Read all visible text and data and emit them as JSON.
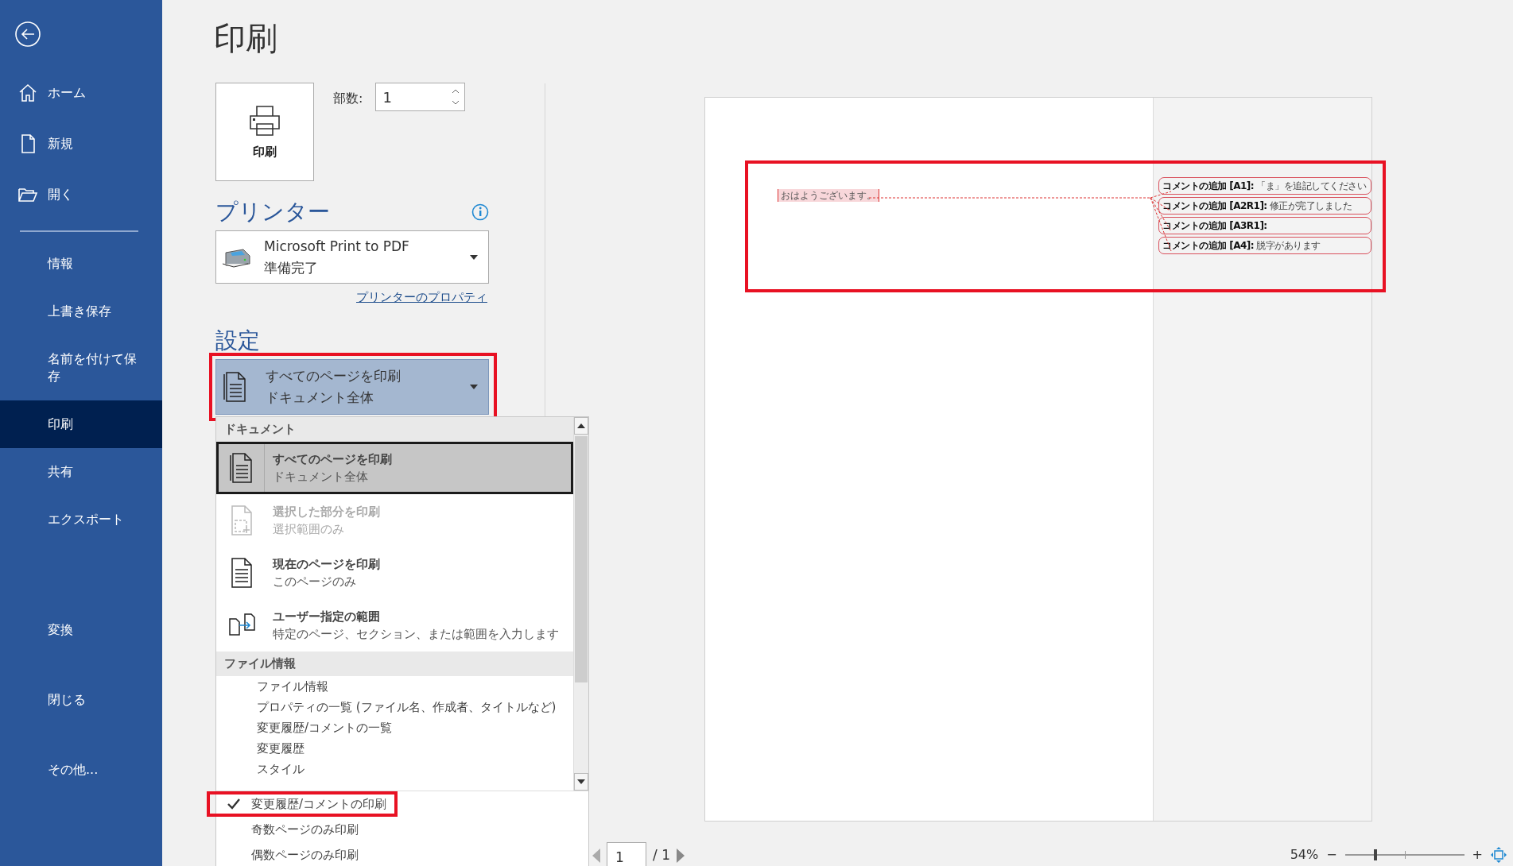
{
  "sidebar": {
    "top_items": [
      {
        "label": "ホーム",
        "kind": "home",
        "selected": false
      },
      {
        "label": "新規",
        "kind": "new",
        "selected": false
      },
      {
        "label": "開く",
        "kind": "open",
        "selected": false
      }
    ],
    "main_items": [
      {
        "label": "情報",
        "selected": false
      },
      {
        "label": "上書き保存",
        "selected": false
      },
      {
        "label": "名前を付けて保存",
        "selected": false
      },
      {
        "label": "印刷",
        "selected": true
      },
      {
        "label": "共有",
        "selected": false
      },
      {
        "label": "エクスポート",
        "selected": false
      }
    ],
    "bottom_items": [
      {
        "label": "変換",
        "selected": false
      },
      {
        "label": "閉じる",
        "selected": false
      },
      {
        "label": "その他...",
        "selected": false
      }
    ]
  },
  "title": "印刷",
  "print_button": {
    "label": "印刷"
  },
  "copies": {
    "label": "部数:",
    "value": "1"
  },
  "printer": {
    "heading": "プリンター",
    "name": "Microsoft Print to PDF",
    "status": "準備完了",
    "properties_link": "プリンターのプロパティ"
  },
  "settings": {
    "heading": "設定",
    "dropdown": {
      "title": "すべてのページを印刷",
      "subtitle": "ドキュメント全体",
      "expanded": true,
      "highlighted": true
    },
    "menu": {
      "sections": [
        {
          "heading": "ドキュメント",
          "options": [
            {
              "kind": "pages",
              "title": "すべてのページを印刷",
              "subtitle": "ドキュメント全体",
              "selected": true,
              "disabled": false
            },
            {
              "kind": "selection",
              "title": "選択した部分を印刷",
              "subtitle": "選択範囲のみ",
              "selected": false,
              "disabled": true
            },
            {
              "kind": "page",
              "title": "現在のページを印刷",
              "subtitle": "このページのみ",
              "selected": false,
              "disabled": false
            },
            {
              "kind": "custom",
              "title": "ユーザー指定の範囲",
              "subtitle": "特定のページ、セクション、または範囲を入力します",
              "selected": false,
              "disabled": false
            }
          ]
        },
        {
          "heading": "ファイル情報",
          "lines": [
            "ファイル情報",
            "プロパティの一覧 (ファイル名、作成者、タイトルなど)",
            "変更履歴/コメントの一覧",
            "変更履歴",
            "スタイル"
          ]
        }
      ],
      "toggles": [
        {
          "label": "変更履歴/コメントの印刷",
          "checked": true,
          "highlighted": true
        },
        {
          "label": "奇数ページのみ印刷",
          "checked": false,
          "highlighted": false
        },
        {
          "label": "偶数ページのみ印刷",
          "checked": false,
          "highlighted": false
        }
      ]
    }
  },
  "preview": {
    "highlighted": true,
    "body_text": "おはようございます。",
    "comments": [
      "**コメントの追加 [A1]:** 「ま」を追記してください",
      "**コメントの追加 [A2R1]:** 修正が完了しました",
      "**コメントの追加 [A3R1]:**",
      "**コメントの追加 [A4]:** 脱字があります"
    ]
  },
  "page_nav": {
    "page": "1",
    "total": "/ 1"
  },
  "zoom": {
    "reading": "54%",
    "zoom_out": "−",
    "zoom_in": "+",
    "level": 0.25
  }
}
